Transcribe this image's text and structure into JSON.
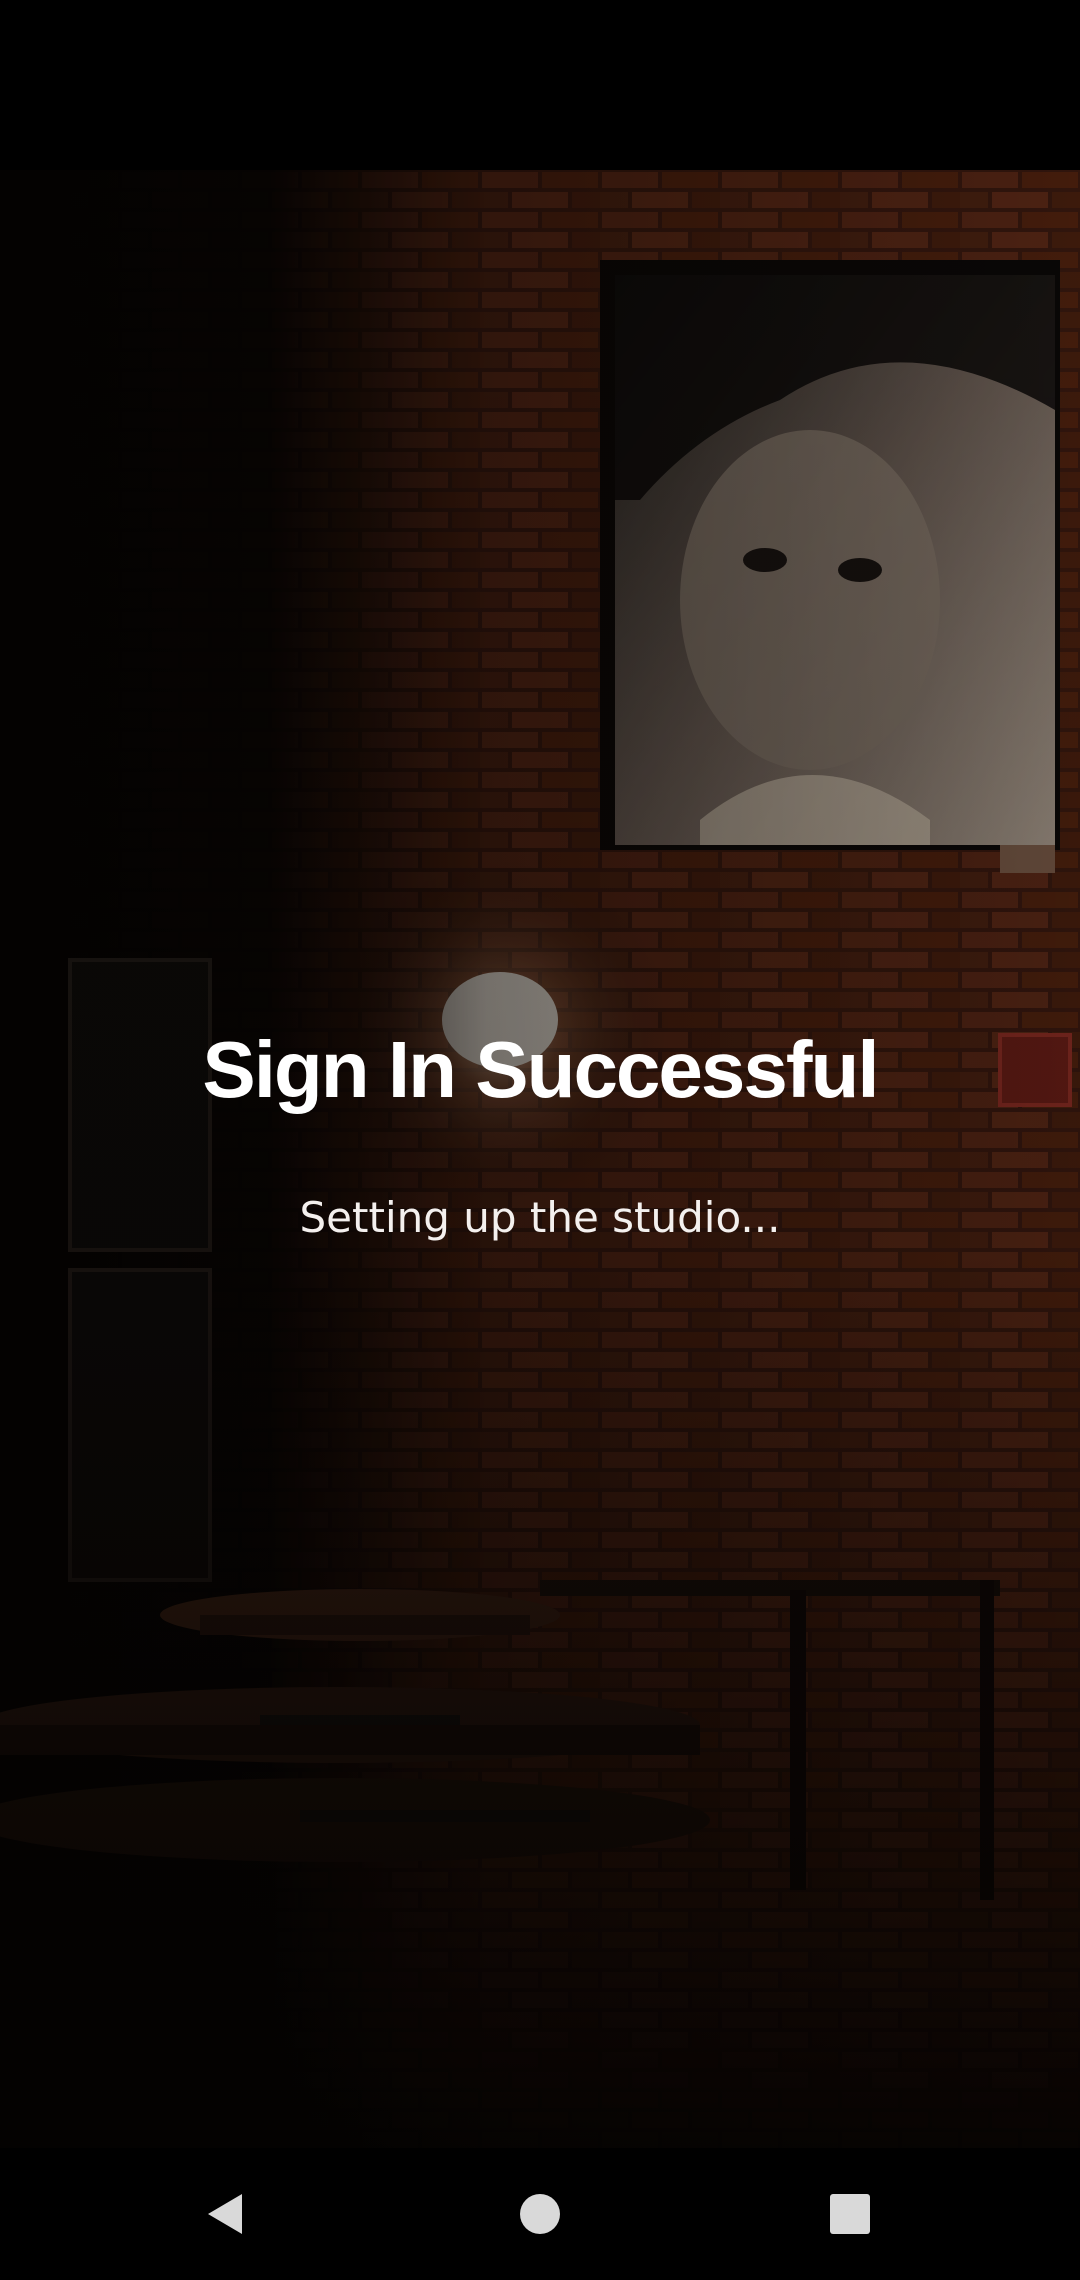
{
  "screen": {
    "title": "Sign In Successful",
    "subtitle": "Setting up the studio..."
  },
  "navigation": {
    "back_icon": "back-triangle-icon",
    "home_icon": "home-circle-icon",
    "recents_icon": "recents-square-icon"
  },
  "colors": {
    "text": "#ffffff",
    "background": "#000000",
    "nav_icon": "#d9d9d9"
  }
}
